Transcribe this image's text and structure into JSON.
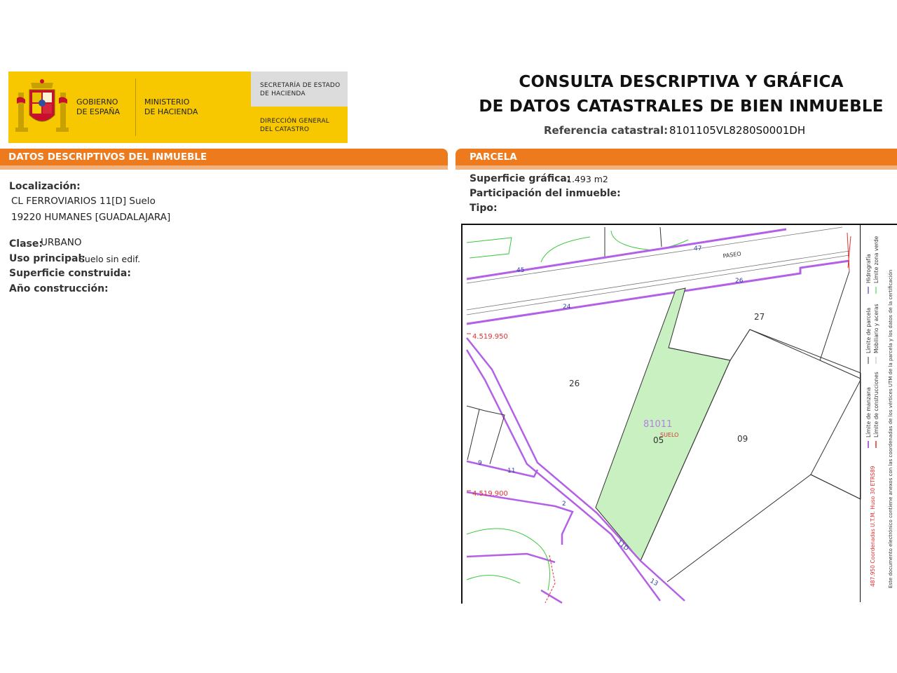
{
  "header": {
    "gobierno": "GOBIERNO\nDE ESPAÑA",
    "ministerio": "MINISTERIO\nDE HACIENDA",
    "secretaria": "SECRETARÍA DE ESTADO\nDE HACIENDA",
    "direccion": "DIRECCIÓN GENERAL\nDEL CATASTRO",
    "title_line1": "CONSULTA DESCRIPTIVA Y GRÁFICA",
    "title_line2": "DE DATOS CATASTRALES DE BIEN INMUEBLE",
    "ref_label": "Referencia catastral:",
    "ref_value": "8101105VL8280S0001DH"
  },
  "descriptivos": {
    "section_title": "DATOS DESCRIPTIVOS DEL INMUEBLE",
    "localizacion_label": "Localización:",
    "address_line1": "CL FERROVIARIOS 11[D] Suelo",
    "address_line2": "19220 HUMANES [GUADALAJARA]",
    "clase_label": "Clase:",
    "clase_value": "URBANO",
    "uso_label": "Uso principal:",
    "uso_value": "Suelo sin edif.",
    "superficie_label": "Superficie construida:",
    "anio_label": "Año construcción:"
  },
  "parcela": {
    "section_title": "PARCELA",
    "superficie_label": "Superficie gráfica:",
    "superficie_value": "1.493 m2",
    "participacion_label": "Participación del inmueble:",
    "tipo_label": "Tipo:"
  },
  "map": {
    "street": "PASEO",
    "coord_y1": "4.519.950",
    "coord_y2": "4.519.900",
    "parcel_code": "81011",
    "parcel_sub": "SUELO",
    "labels": {
      "n47": "47",
      "n45": "45",
      "n26a": "26",
      "n24": "24",
      "n27": "27",
      "n26": "26",
      "n05": "05",
      "n09": "09",
      "n9": "9",
      "n11": "11",
      "n2": "2",
      "n11d": "11D",
      "n13": "13"
    },
    "colors": {
      "parcel_fill": "#c8f0c0",
      "manzana": "#b460e6",
      "hydro": "#e03030",
      "green": "#3cc83c",
      "lines": "#333333"
    }
  },
  "legend": {
    "col1a": "Límite de manzana",
    "col1b": "Límite de parcela",
    "col1c": "Hidrografía",
    "col2a": "Límite de construcciones",
    "col2b": "Mobiliario y aceras",
    "col2c": "Límite zona verde",
    "coords": "487.950 Coordenadas U.T.M. Huso 30 ETRS89",
    "note": "Este documento electrónico contiene anexos con las coordenadas de los vértices UTM de la parcela y los datos de la certificación"
  }
}
